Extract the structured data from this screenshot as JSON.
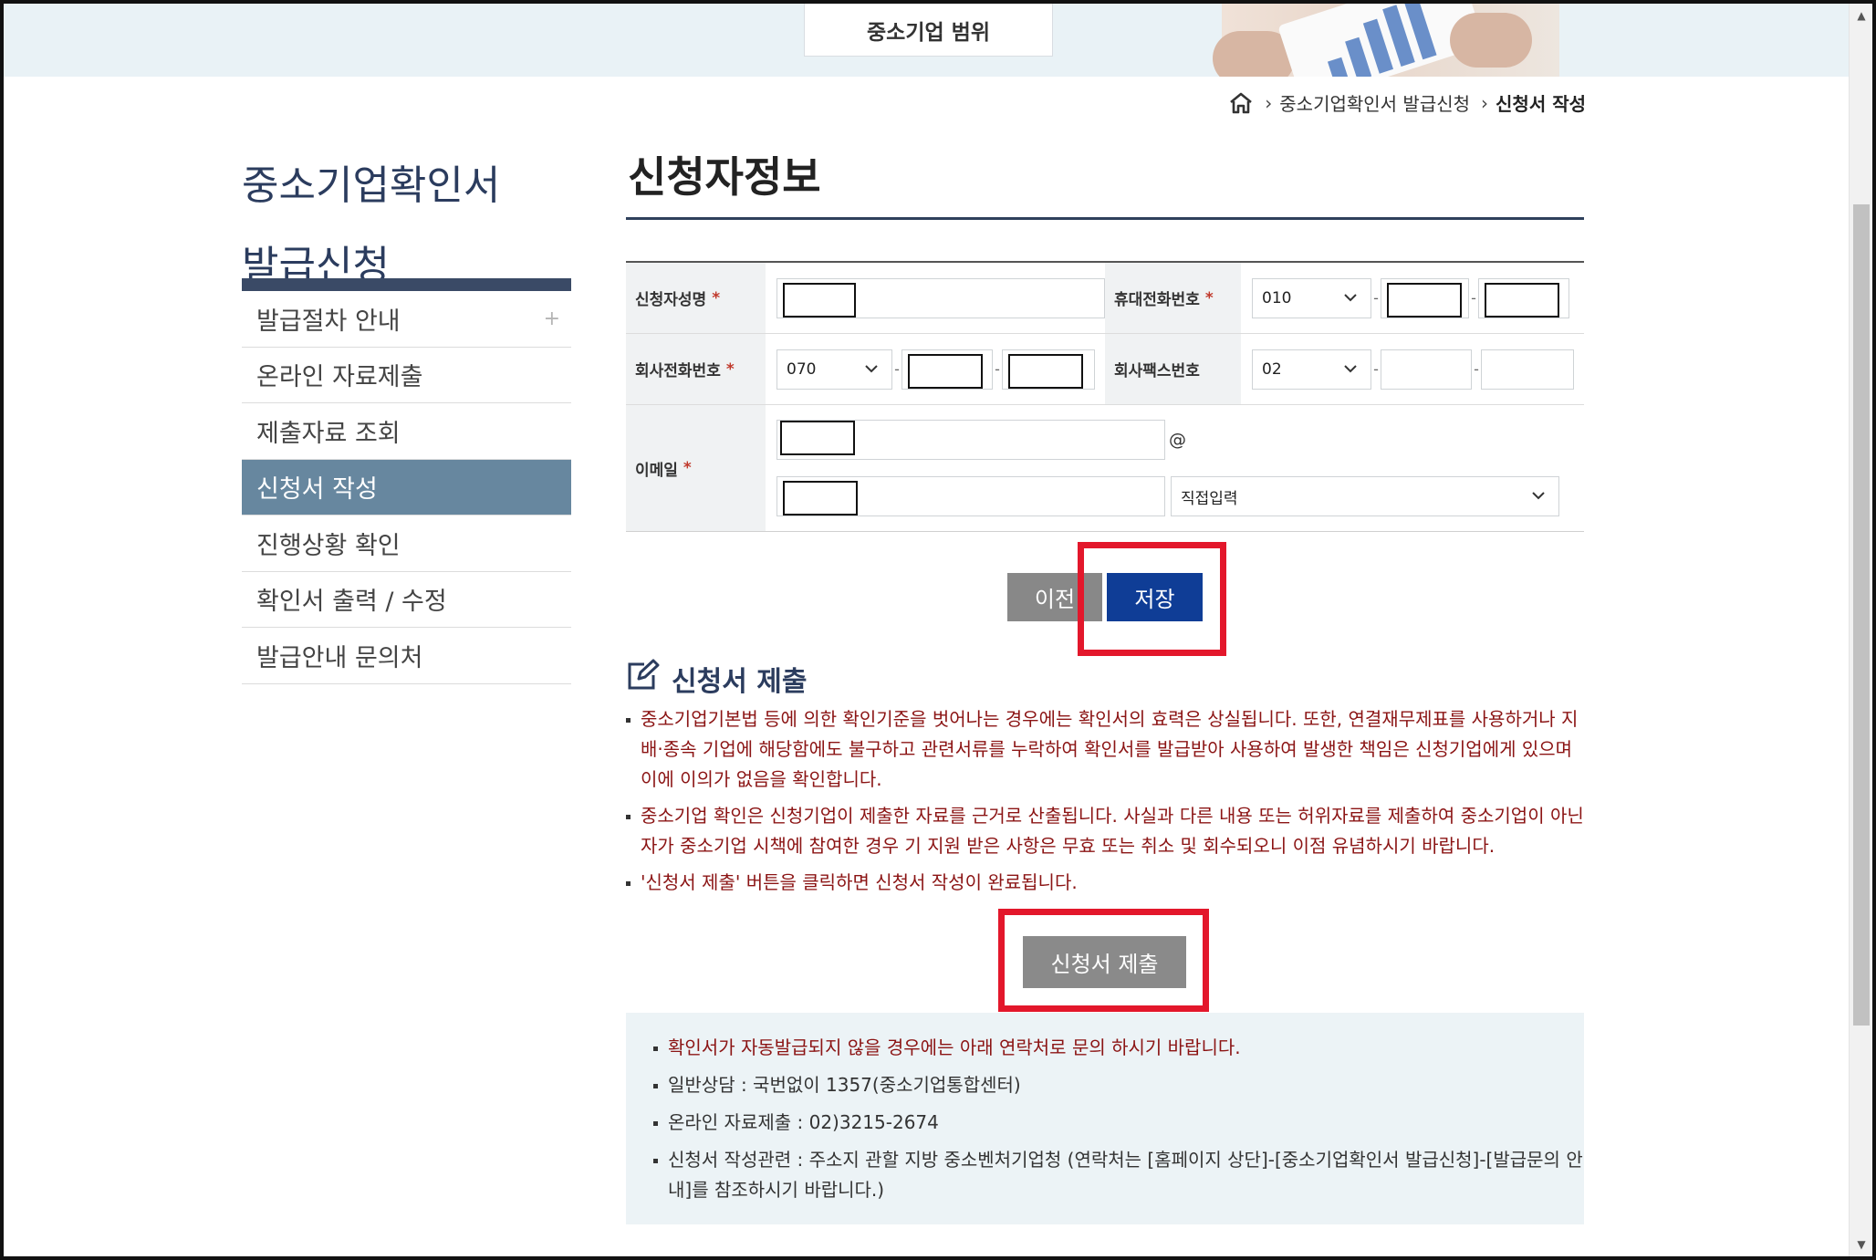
{
  "header": {
    "top_tab": "중소기업 범위"
  },
  "breadcrumb": {
    "level1": "중소기업확인서 발급신청",
    "current": "신청서 작성"
  },
  "sidebar": {
    "title_line1": "중소기업확인서",
    "title_line2": "발급신청",
    "items": [
      {
        "label": "발급절차 안내",
        "expand": "+"
      },
      {
        "label": "온라인 자료제출"
      },
      {
        "label": "제출자료 조회"
      },
      {
        "label": "신청서 작성",
        "active": true
      },
      {
        "label": "진행상황 확인"
      },
      {
        "label": "확인서 출력 / 수정"
      },
      {
        "label": "발급안내 문의처"
      }
    ]
  },
  "form": {
    "title": "신청자정보",
    "required_mark": "*",
    "applicant_name_label": "신청자성명",
    "mobile_label": "휴대전화번호",
    "mobile_prefix": "010",
    "company_phone_label": "회사전화번호",
    "company_phone_prefix": "070",
    "company_fax_label": "회사팩스번호",
    "company_fax_prefix": "02",
    "email_label": "이메일",
    "email_at": "@",
    "email_domain_select": "직접입력",
    "dash": "-"
  },
  "buttons": {
    "prev": "이전",
    "save": "저장",
    "submit": "신청서 제출"
  },
  "submit_section": {
    "heading": "신청서 제출",
    "notes": [
      "중소기업기본법 등에 의한 확인기준을 벗어나는 경우에는 확인서의 효력은 상실됩니다. 또한, 연결재무제표를 사용하거나 지배·종속 기업에 해당함에도 불구하고 관련서류를 누락하여 확인서를 발급받아 사용하여 발생한 책임은 신청기업에게 있으며 이에 이의가 없음을 확인합니다.",
      "중소기업 확인은 신청기업이 제출한 자료를 근거로 산출됩니다. 사실과 다른 내용 또는 허위자료를 제출하여 중소기업이 아닌 자가 중소기업 시책에 참여한 경우 기 지원 받은 사항은 무효 또는 취소 및 회수되오니 이점 유념하시기 바랍니다.",
      "'신청서 제출' 버튼을 클릭하면 신청서 작성이 완료됩니다."
    ]
  },
  "info_box": {
    "items": [
      "확인서가 자동발급되지 않을 경우에는 아래 연락처로 문의 하시기 바랍니다.",
      "일반상담 : 국번없이 1357(중소기업통합센터)",
      "온라인 자료제출 : 02)3215-2674",
      "신청서 작성관련 : 주소지 관할 지방 중소벤처기업청 (연락처는 [홈페이지 상단]-[중소기업확인서 발급신청]-[발급문의 안내]를 참조하시기 바랍니다.)"
    ]
  },
  "colors": {
    "highlight": "#e3172b",
    "save_button": "#0f3d96",
    "sidebar_active": "#67879f",
    "notice_text": "#8b1414"
  }
}
